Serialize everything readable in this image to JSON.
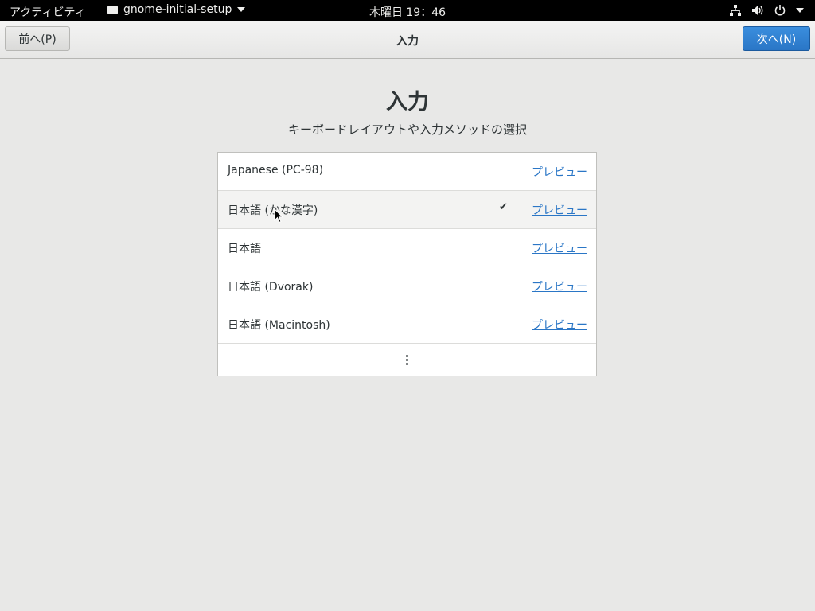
{
  "topbar": {
    "activities": "アクティビティ",
    "app_name": "gnome-initial-setup",
    "clock": "木曜日 19：46"
  },
  "header": {
    "prev_label": "前へ(P)",
    "title": "入力",
    "next_label": "次へ(N)"
  },
  "main": {
    "heading": "入力",
    "subtitle": "キーボードレイアウトや入力メソッドの選択",
    "layouts": [
      {
        "name": "Japanese (PC-98)",
        "preview": "プレビュー",
        "selected": false
      },
      {
        "name": "日本語 (かな漢字)",
        "preview": "プレビュー",
        "selected": true
      },
      {
        "name": "日本語",
        "preview": "プレビュー",
        "selected": false
      },
      {
        "name": "日本語 (Dvorak)",
        "preview": "プレビュー",
        "selected": false
      },
      {
        "name": "日本語 (Macintosh)",
        "preview": "プレビュー",
        "selected": false
      }
    ],
    "check_mark": "✔"
  },
  "colors": {
    "accent": "#2a76c6",
    "topbar": "#000000",
    "background": "#e8e8e7"
  },
  "icons": [
    "network-wired-icon",
    "volume-icon",
    "power-icon",
    "chevron-down-icon",
    "more-vertical-icon",
    "mouse-pointer-icon"
  ]
}
